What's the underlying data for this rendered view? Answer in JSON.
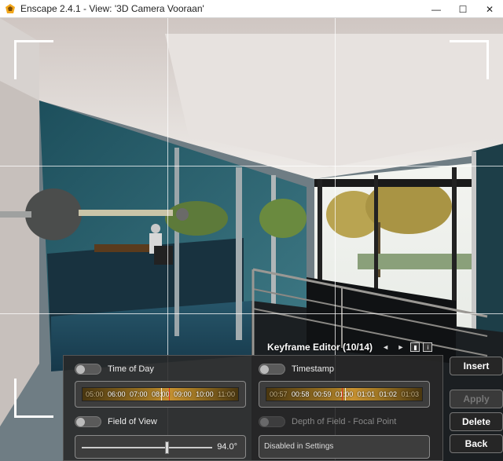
{
  "window": {
    "title": "Enscape 2.4.1 - View: '3D Camera Vooraan'",
    "minimize": "—",
    "maximize": "☐",
    "close": "✕"
  },
  "colors": {
    "accent": "#f2a71b",
    "panel": "#282828",
    "marker": "#e03020"
  },
  "keyframe_editor": {
    "title": "Keyframe Editor (10/14)",
    "nav": "◄ ►",
    "info_label": "i",
    "time_of_day": {
      "label": "Time of Day",
      "ticks": [
        "05:00",
        "06:00",
        "07:00",
        "08:00",
        "09:00",
        "10:00",
        "11:00"
      ]
    },
    "timestamp": {
      "label": "Timestamp",
      "ticks": [
        "00:57",
        "00:58",
        "00:59",
        "01:00",
        "01:01",
        "01:02",
        "01:03"
      ]
    },
    "field_of_view": {
      "label": "Field of View",
      "value": "94.0°",
      "level": 0.65
    },
    "depth_of_field": {
      "label": "Depth of Field - Focal Point",
      "status": "Disabled in Settings"
    }
  },
  "buttons": {
    "insert": "Insert",
    "apply": "Apply",
    "delete": "Delete",
    "back": "Back"
  }
}
